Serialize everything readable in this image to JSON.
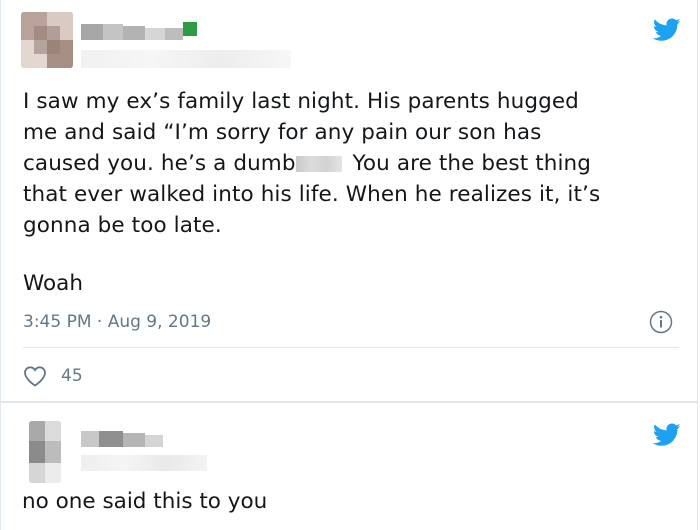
{
  "tweet": {
    "text_lines": [
      "I saw my ex’s family last night. His parents hugged",
      "me and said “I’m sorry for any pain our son has",
      "caused you. he’s a dumb",
      "You are the best thing",
      "that ever walked into his life. When he realizes it, it’s",
      "gonna be too late."
    ],
    "reply_line": "Woah",
    "timestamp": "3:45 PM · Aug 9, 2019",
    "likes": "45",
    "icons": [
      "twitter-bird-icon",
      "info-icon",
      "heart-icon"
    ],
    "accent_color": "#1da1f2"
  },
  "reply_tweet": {
    "text": "no one said this to you",
    "icons": [
      "twitter-bird-icon"
    ]
  }
}
